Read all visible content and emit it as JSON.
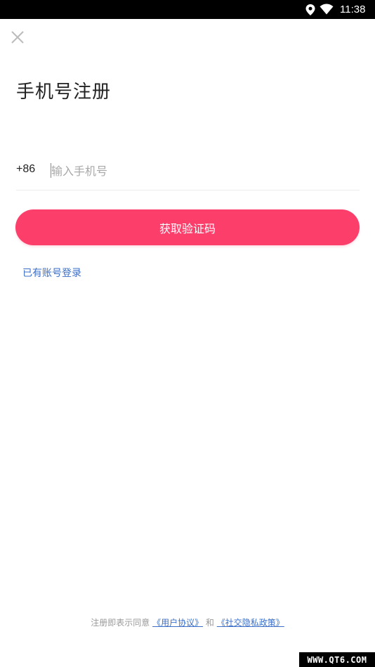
{
  "status_bar": {
    "time": "11:38",
    "icons": [
      "location-icon",
      "wifi-icon"
    ]
  },
  "header": {
    "close_icon": "close-icon"
  },
  "page": {
    "title": "手机号注册"
  },
  "phone": {
    "country_code": "+86",
    "placeholder": "输入手机号",
    "value": ""
  },
  "actions": {
    "get_code_label": "获取验证码",
    "login_link": "已有账号登录"
  },
  "footer": {
    "prefix": "注册即表示同意",
    "user_agreement": "《用户协议》",
    "conjunction": "和",
    "privacy_policy": "《社交隐私政策》"
  },
  "watermark": {
    "text": "WWW.QT6.COM"
  },
  "colors": {
    "accent": "#fc3e6b",
    "link": "#3b6fc9",
    "status_bar": "#000000"
  }
}
